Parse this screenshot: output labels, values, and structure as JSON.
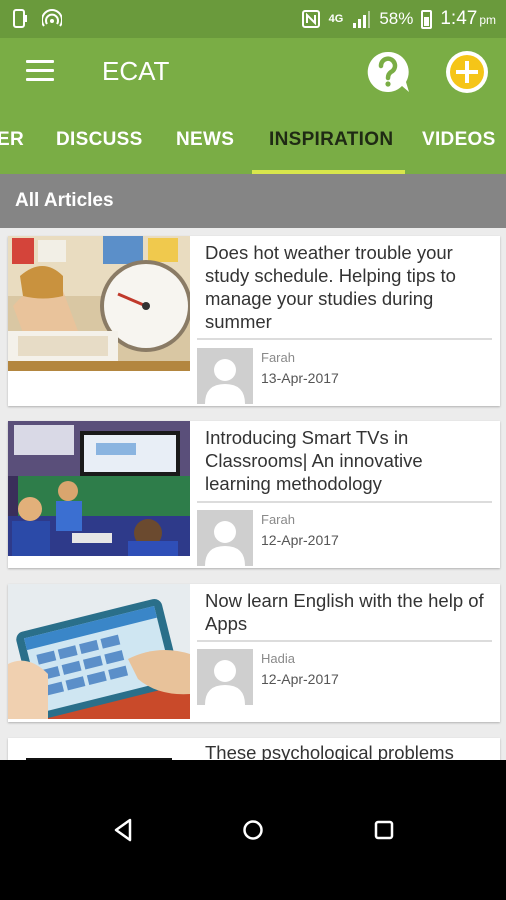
{
  "status_bar": {
    "network": "4G",
    "battery": "58%",
    "time": "1:47",
    "ampm": "pm"
  },
  "app_bar": {
    "title": "ECAT"
  },
  "tabs": [
    {
      "label": "ER"
    },
    {
      "label": "DISCUSS"
    },
    {
      "label": "NEWS"
    },
    {
      "label": "INSPIRATION"
    },
    {
      "label": "VIDEOS"
    }
  ],
  "section": {
    "title": "All Articles"
  },
  "articles": [
    {
      "title": "Does hot weather trouble your study schedule. Helping tips to manage your studies during summer",
      "author": "Farah",
      "date": "13-Apr-2017"
    },
    {
      "title": "Introducing Smart TVs in Classrooms| An innovative learning methodology",
      "author": "Farah",
      "date": "12-Apr-2017"
    },
    {
      "title": "Now learn English with the help of Apps",
      "author": "Hadia",
      "date": "12-Apr-2017"
    },
    {
      "title": "These psychological problems",
      "author": "",
      "date": ""
    }
  ],
  "colors": {
    "status_bar": "#6a9a3c",
    "app_bar": "#7aad45",
    "tab_indicator": "#d8e64c",
    "add_button": "#f5c518",
    "section_header": "#858585"
  }
}
